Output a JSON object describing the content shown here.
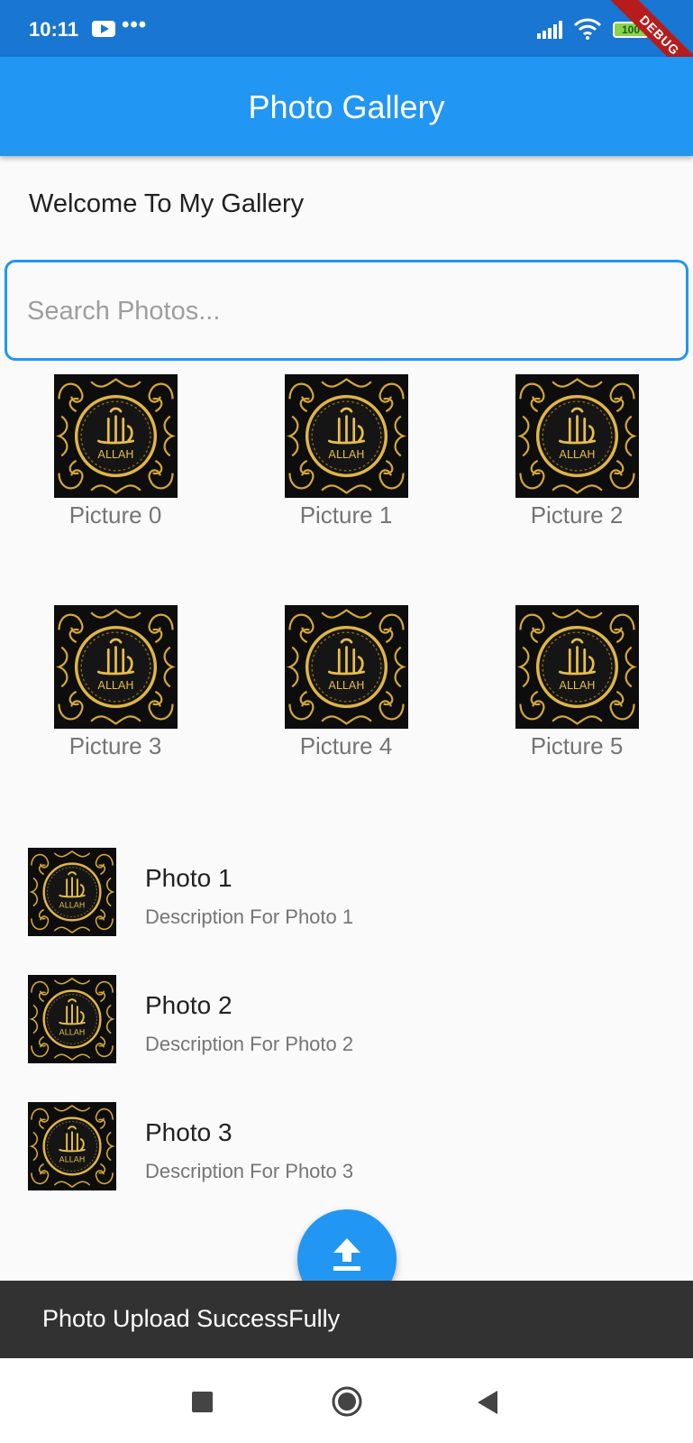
{
  "status_bar": {
    "time": "10:11",
    "dots": "•••",
    "battery": "100",
    "debug": "DEBUG"
  },
  "app_bar": {
    "title": "Photo Gallery"
  },
  "welcome": "Welcome To My Gallery",
  "search": {
    "placeholder": "Search Photos..."
  },
  "grid": [
    {
      "caption": "Picture 0"
    },
    {
      "caption": "Picture 1"
    },
    {
      "caption": "Picture 2"
    },
    {
      "caption": "Picture 3"
    },
    {
      "caption": "Picture 4"
    },
    {
      "caption": "Picture 5"
    }
  ],
  "thumbnail_text": "ALLAH",
  "list": [
    {
      "title": "Photo 1",
      "subtitle": "Description For Photo 1"
    },
    {
      "title": "Photo 2",
      "subtitle": "Description For Photo 2"
    },
    {
      "title": "Photo 3",
      "subtitle": "Description For Photo 3"
    }
  ],
  "fab": {
    "icon": "upload-icon"
  },
  "snackbar": {
    "message": "Photo Upload SuccessFully"
  },
  "colors": {
    "status_bar": "#1976d2",
    "app_bar": "#2196f3",
    "snackbar": "#323232",
    "thumbnail_gold": "#d4a73a"
  }
}
